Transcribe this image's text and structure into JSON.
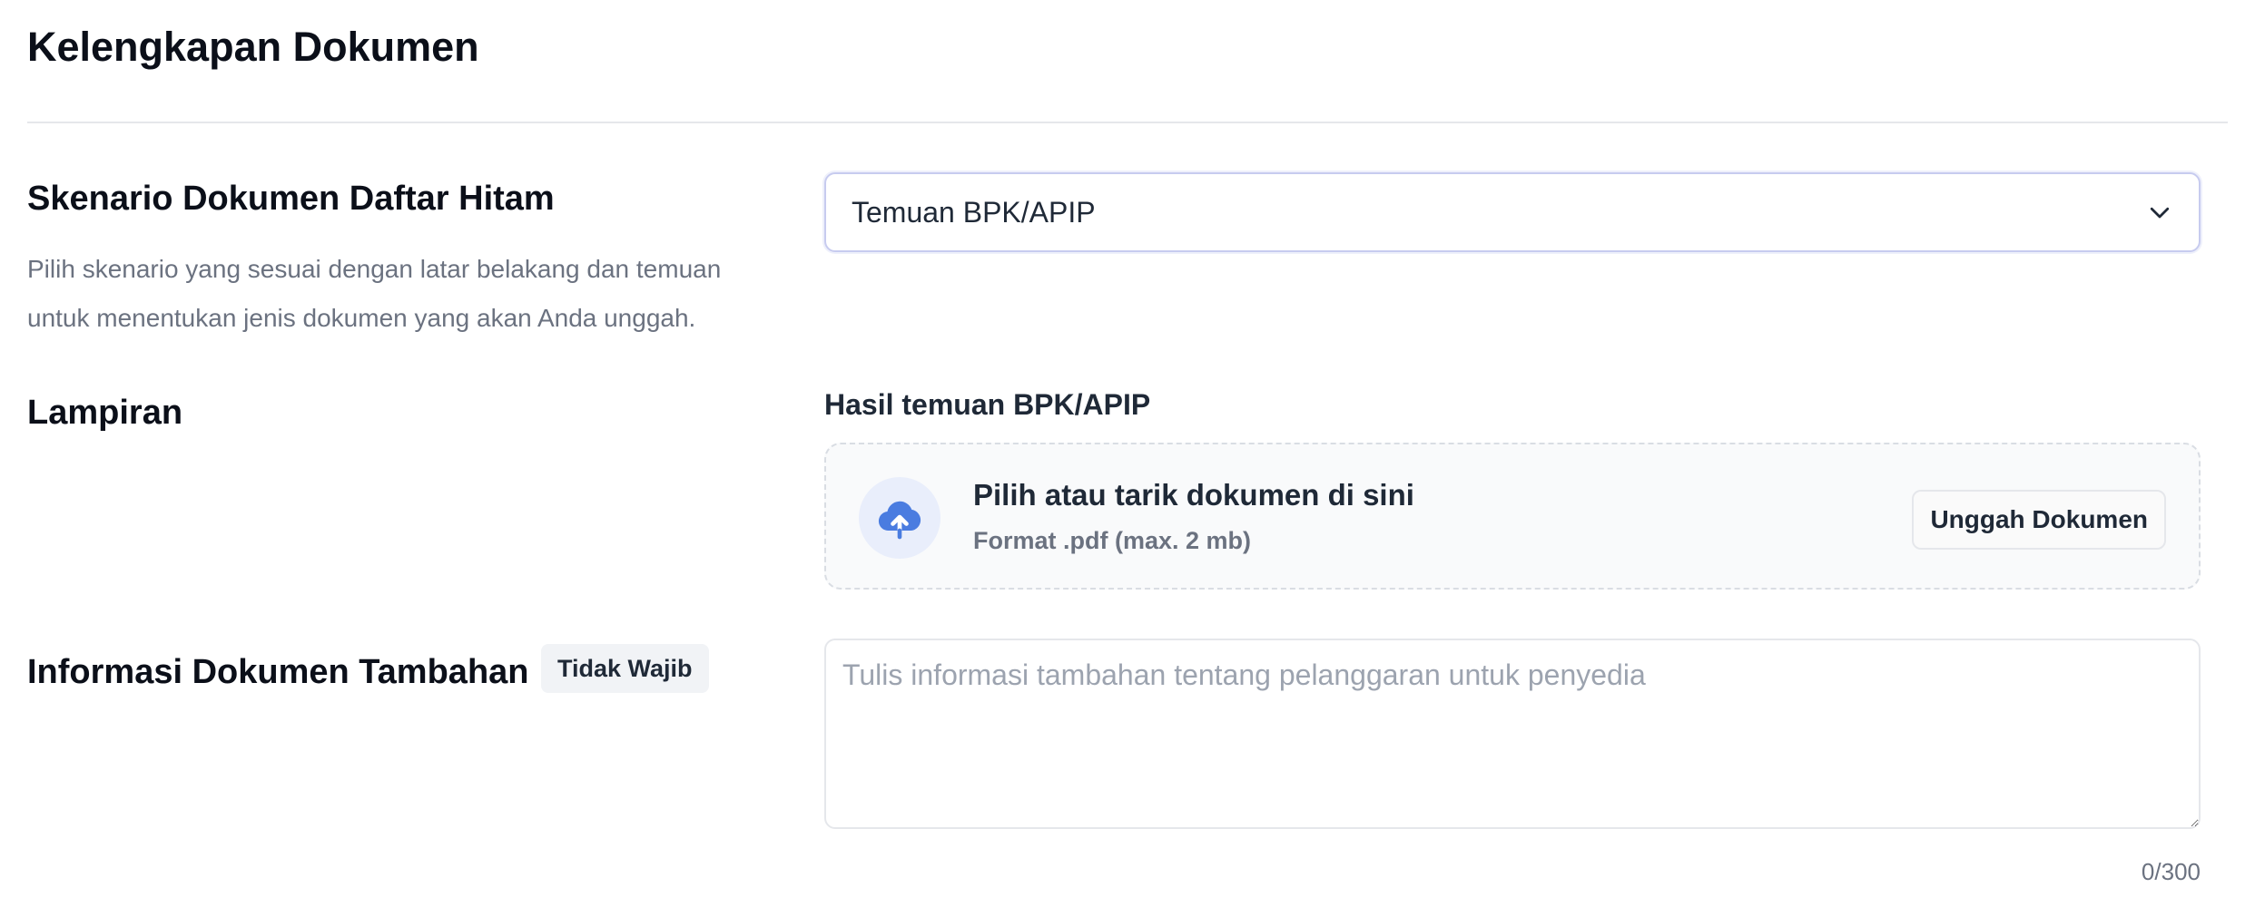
{
  "page": {
    "title": "Kelengkapan Dokumen"
  },
  "scenario": {
    "title": "Skenario Dokumen Daftar Hitam",
    "description": "Pilih skenario yang sesuai dengan latar belakang dan temuan untuk menentukan jenis dokumen yang akan Anda unggah.",
    "selected": "Temuan BPK/APIP",
    "chevron_icon": "chevron-down-icon"
  },
  "attachment": {
    "title": "Lampiran",
    "field_label": "Hasil temuan BPK/APIP",
    "dropzone_title": "Pilih atau tarik dokumen di sini",
    "dropzone_hint": "Format .pdf (max. 2 mb)",
    "upload_button": "Unggah Dokumen",
    "upload_icon": "cloud-upload-icon",
    "accent_color": "#4a7ce0"
  },
  "additional_info": {
    "title": "Informasi Dokumen Tambahan",
    "badge": "Tidak Wajib",
    "placeholder": "Tulis informasi tambahan tentang pelanggaran untuk penyedia",
    "value": "",
    "counter": "0/300"
  }
}
